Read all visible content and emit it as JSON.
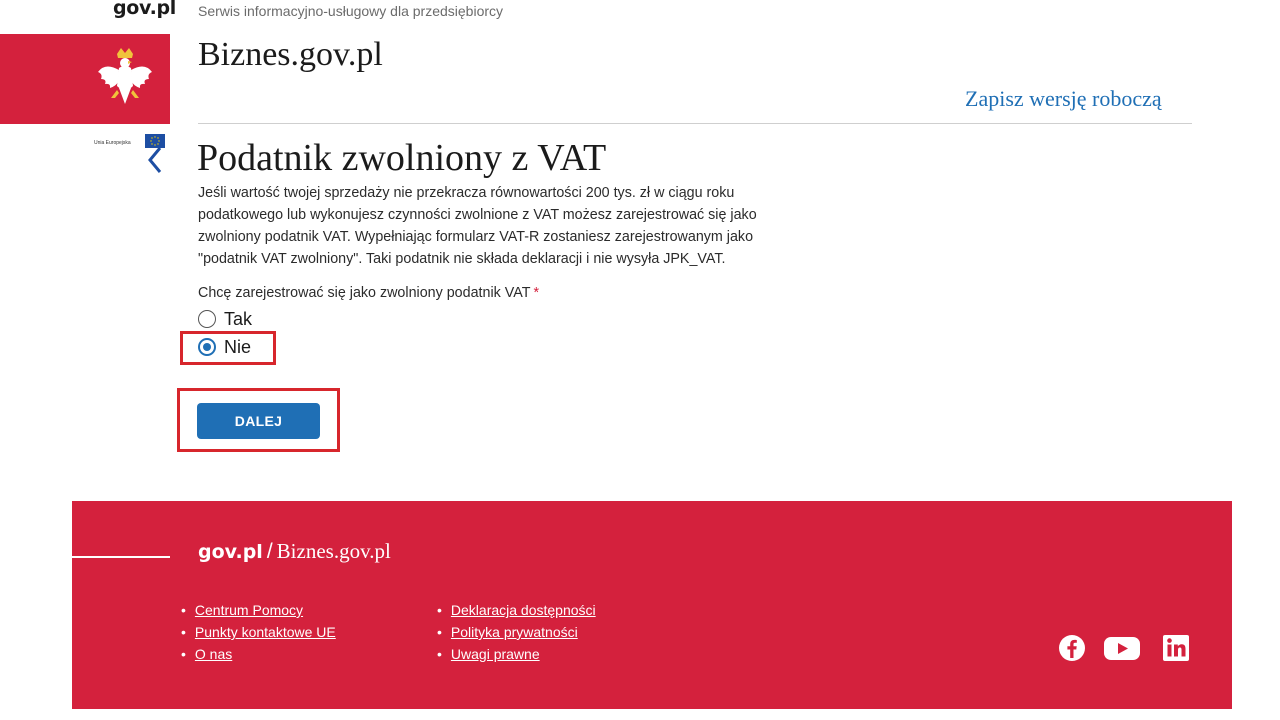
{
  "header": {
    "gov_logo": "gov.pl",
    "service_description": "Serwis informacyjno-usługowy dla przedsiębiorcy",
    "site_title": "Biznes.gov.pl",
    "save_draft_link": "Zapisz wersję roboczą",
    "eu_label": "Unia Europejska"
  },
  "form": {
    "title": "Podatnik zwolniony z VAT",
    "intro": "Jeśli wartość twojej sprzedaży nie przekracza równowartości 200 tys. zł w ciągu roku podatkowego lub wykonujesz czynności zwolnione z VAT możesz zarejestrować się jako zwolniony podatnik VAT. Wypełniając formularz VAT-R zostaniesz zarejestrowanym jako \"podatnik VAT zwolniony\". Taki podatnik nie składa deklaracji i nie wysyła JPK_VAT.",
    "question": "Chcę zarejestrować się jako zwolniony podatnik VAT",
    "required_marker": "*",
    "options": [
      {
        "label": "Tak",
        "checked": false
      },
      {
        "label": "Nie",
        "checked": true
      }
    ],
    "submit_label": "DALEJ"
  },
  "footer": {
    "brand_gov": "gov.pl",
    "brand_separator": "/",
    "brand_site": "Biznes.gov.pl",
    "links_col1": [
      "Centrum Pomocy",
      "Punkty kontaktowe UE",
      "O nas"
    ],
    "links_col2": [
      "Deklaracja dostępności",
      "Polityka prywatności",
      "Uwagi prawne"
    ],
    "social_icons": [
      "facebook-icon",
      "youtube-icon",
      "linkedin-icon"
    ]
  },
  "colors": {
    "brand_red": "#d4213d",
    "link_blue": "#1f6fb5",
    "highlight_red": "#d7262c"
  }
}
